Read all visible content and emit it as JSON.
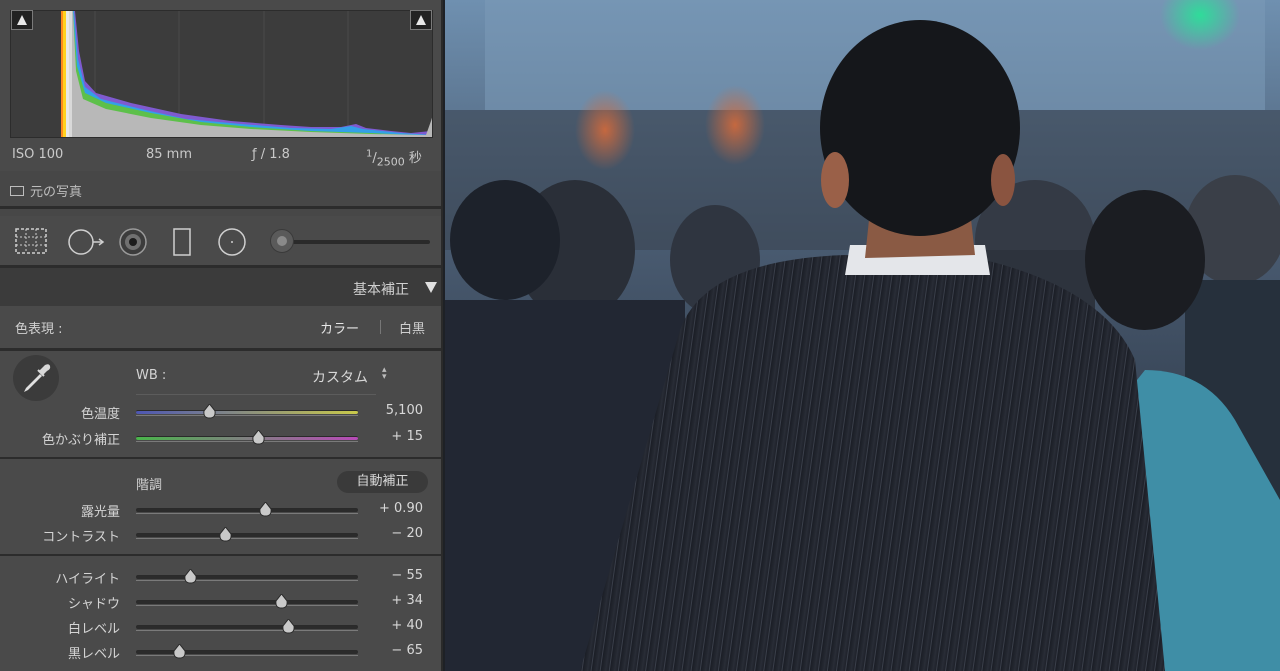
{
  "histogram": {
    "exif": {
      "iso": "ISO 100",
      "focal": "85 mm",
      "aperture": "ƒ / 1.8",
      "shutter_num": "1",
      "shutter_den": "2500",
      "shutter_unit": "秒"
    },
    "original_photo_label": "元の写真"
  },
  "section": {
    "title": "基本補正"
  },
  "treatment": {
    "label": "色表現 :",
    "color": "カラー",
    "bw": "白黒"
  },
  "wb": {
    "label": "WB :",
    "value": "カスタム"
  },
  "wb_sliders": [
    {
      "label": "色温度",
      "value": "5,100",
      "level": 0.33
    },
    {
      "label": "色かぶり補正",
      "value": "+ 15",
      "level": 0.55
    }
  ],
  "tone": {
    "label": "階調",
    "auto_label": "自動補正"
  },
  "tone_sliders": [
    {
      "label": "露光量",
      "value": "+ 0.90",
      "level": 0.58
    },
    {
      "label": "コントラスト",
      "value": "− 20",
      "level": 0.4
    }
  ],
  "presence_sliders": [
    {
      "label": "ハイライト",
      "value": "− 55",
      "level": 0.245
    },
    {
      "label": "シャドウ",
      "value": "+ 34",
      "level": 0.655
    },
    {
      "label": "白レベル",
      "value": "+ 40",
      "level": 0.685
    },
    {
      "label": "黒レベル",
      "value": "− 65",
      "level": 0.195
    }
  ],
  "colors": {
    "panel": "#474747",
    "accent_temp_start": "#4d56b3",
    "accent_temp_end": "#c9c94a",
    "accent_tint_start": "#49b54a",
    "accent_tint_end": "#b84ab8"
  }
}
